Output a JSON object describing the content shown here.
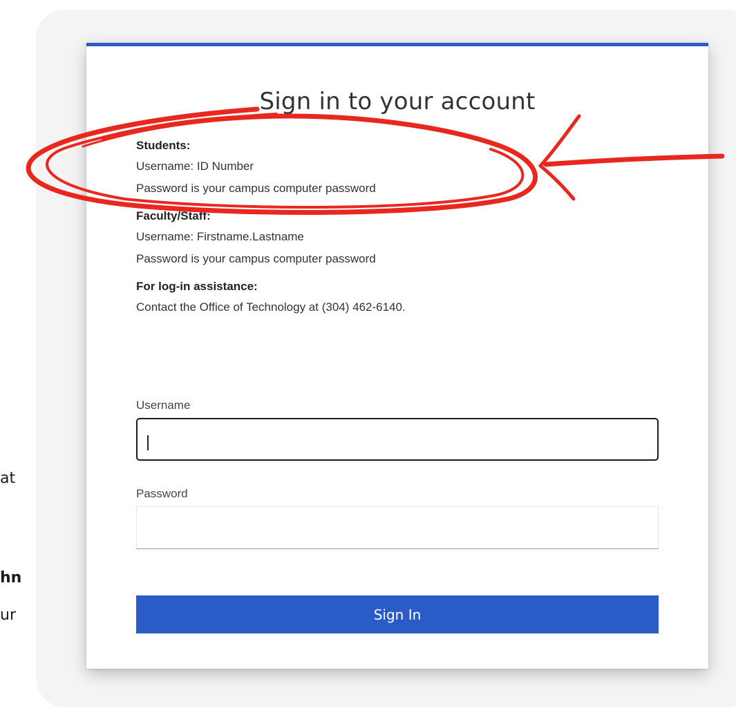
{
  "side_text": {
    "line1": "at",
    "line2": "hn",
    "line3": "ur"
  },
  "card": {
    "title": "Sign in to your account",
    "info": {
      "students": {
        "heading": "Students:",
        "username": "Username: ID Number",
        "password": "Password is your campus computer password"
      },
      "faculty": {
        "heading": "Faculty/Staff:",
        "username": "Username: Firstname.Lastname",
        "password": "Password is your campus computer password"
      },
      "assistance": {
        "heading": "For log-in assistance:",
        "contact": "Contact the Office of Technology at (304) 462-6140."
      }
    },
    "form": {
      "username_label": "Username",
      "username_value": "",
      "password_label": "Password",
      "password_value": "",
      "submit_label": "Sign In"
    }
  },
  "colors": {
    "accent": "#2a5bc7",
    "annotation": "#e8281e"
  }
}
